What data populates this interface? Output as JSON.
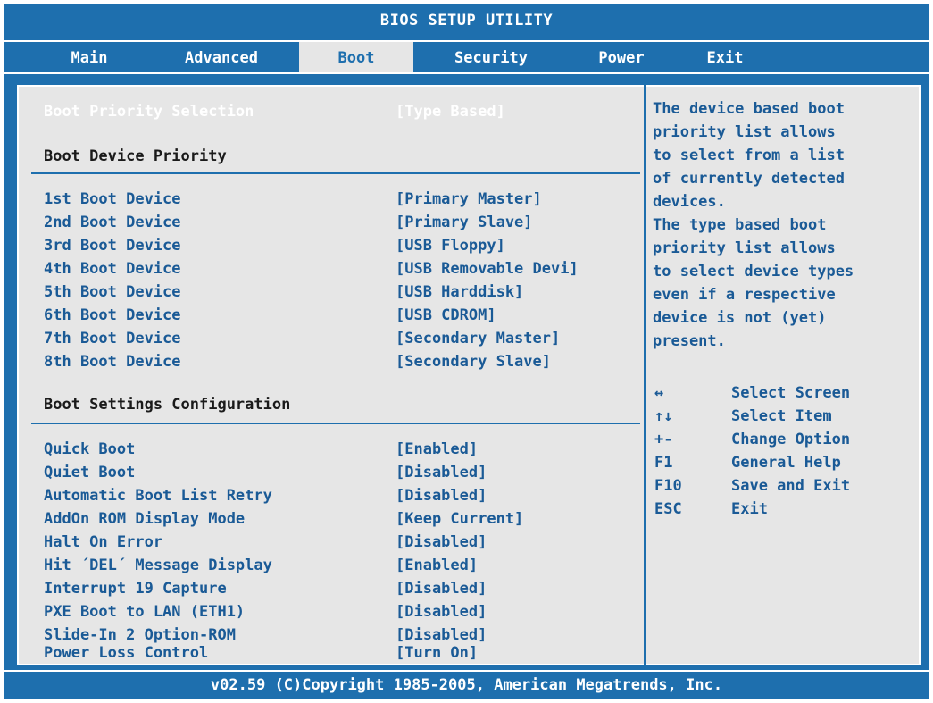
{
  "title": "BIOS SETUP UTILITY",
  "tabs": [
    {
      "label": "Main"
    },
    {
      "label": "Advanced"
    },
    {
      "label": "Boot"
    },
    {
      "label": "Security"
    },
    {
      "label": "Power"
    },
    {
      "label": "Exit"
    }
  ],
  "active_tab": "Boot",
  "boot_priority": {
    "label": "Boot Priority Selection",
    "value": "[Type Based]"
  },
  "boot_device_priority": {
    "heading": "Boot Device Priority",
    "items": [
      {
        "label": "1st Boot Device",
        "value": "[Primary Master]"
      },
      {
        "label": "2nd Boot Device",
        "value": "[Primary Slave]"
      },
      {
        "label": "3rd Boot Device",
        "value": "[USB Floppy]"
      },
      {
        "label": "4th Boot Device",
        "value": "[USB Removable Devi]"
      },
      {
        "label": "5th Boot Device",
        "value": "[USB Harddisk]"
      },
      {
        "label": "6th Boot Device",
        "value": "[USB CDROM]"
      },
      {
        "label": "7th Boot Device",
        "value": "[Secondary Master]"
      },
      {
        "label": "8th Boot Device",
        "value": "[Secondary Slave]"
      }
    ]
  },
  "boot_settings": {
    "heading": "Boot Settings Configuration",
    "items": [
      {
        "label": "Quick Boot",
        "value": "[Enabled]"
      },
      {
        "label": "Quiet Boot",
        "value": "[Disabled]"
      },
      {
        "label": "Automatic Boot List Retry",
        "value": "[Disabled]"
      },
      {
        "label": "AddOn ROM Display Mode",
        "value": "[Keep Current]"
      },
      {
        "label": "Halt On Error",
        "value": "[Disabled]"
      },
      {
        "label": "Hit ´DEL´ Message Display",
        "value": "[Enabled]"
      },
      {
        "label": "Interrupt 19 Capture",
        "value": "[Disabled]"
      },
      {
        "label": "PXE Boot to LAN (ETH1)",
        "value": "[Disabled]"
      },
      {
        "label": "Slide-In 2 Option-ROM",
        "value": "[Disabled]"
      },
      {
        "label": "Power Loss Control",
        "value": "[Turn On]"
      }
    ]
  },
  "help_lines": [
    "The device based boot",
    "priority list allows",
    "to select from a list",
    "of currently detected",
    "devices.",
    "The type based boot",
    "priority list allows",
    "to select device types",
    "even if a respective",
    "device is not (yet)",
    "present."
  ],
  "keys": [
    {
      "key": "↔",
      "desc": "Select Screen"
    },
    {
      "key": "↑↓",
      "desc": "Select Item"
    },
    {
      "key": "+-",
      "desc": "Change Option"
    },
    {
      "key": "F1",
      "desc": "General Help"
    },
    {
      "key": "F10",
      "desc": "Save and Exit"
    },
    {
      "key": "ESC",
      "desc": "Exit"
    }
  ],
  "footer": "v02.59 (C)Copyright 1985-2005, American Megatrends, Inc.",
  "colors": {
    "bios_blue": "#1e6fae",
    "panel_gray": "#e6e6e6",
    "highlight": "#ffffff"
  }
}
